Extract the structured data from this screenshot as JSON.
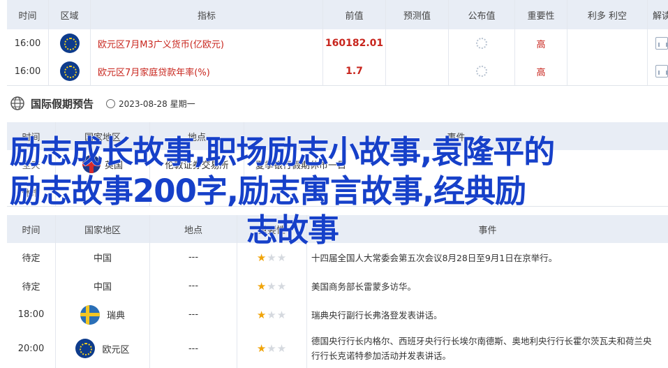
{
  "top_table": {
    "headers": [
      "时间",
      "区域",
      "指标",
      "前值",
      "预测值",
      "公布值",
      "重要性",
      "利多 利空",
      "解读"
    ],
    "rows": [
      {
        "time": "16:00",
        "region_icon": "eu-flag-icon",
        "indicator": "欧元区7月M3广义货币(亿欧元)",
        "previous": "160182.01",
        "forecast": "",
        "published": "",
        "importance": "高"
      },
      {
        "time": "16:00",
        "region_icon": "eu-flag-icon",
        "indicator": "欧元区7月家庭贷款年率(%)",
        "previous": "1.7",
        "forecast": "",
        "published": "",
        "importance": "高"
      }
    ]
  },
  "holiday_section": {
    "title": "国际假期预告",
    "date": "2023-08-28 星期一",
    "headers": [
      "时间",
      "国家地区",
      "地点",
      "事件"
    ],
    "partial_row": {
      "time": "全天",
      "country": "英国",
      "place": "伦敦证券交易所",
      "event": "夏季银行假期休市一日"
    },
    "partial_row2": {
      "time": "休市"
    }
  },
  "event_section": {
    "headers": [
      "时间",
      "国家地区",
      "地点",
      "重要性",
      "事件"
    ],
    "rows": [
      {
        "time": "待定",
        "country": "中国",
        "place": "---",
        "stars": 1,
        "event": "十四届全国人大常委会第五次会议8月28日至9月1日在京举行。"
      },
      {
        "time": "待定",
        "country": "中国",
        "place": "---",
        "stars": 1,
        "event": "美国商务部长雷蒙多访华。"
      },
      {
        "time": "18:00",
        "country": "瑞典",
        "place": "---",
        "stars": 1,
        "event": "瑞典央行副行长弗洛登发表讲话。"
      },
      {
        "time": "20:00",
        "country": "欧元区",
        "place": "---",
        "stars": 1,
        "event": "德国央行行长内格尔、西班牙央行行长埃尔南德斯、奥地利央行行长霍尔茨瓦夫和荷兰央行行长克诺特参加活动并发表讲话。"
      }
    ]
  },
  "overlay_title": {
    "line1": "励志成长故事,职场励志小故事,袁隆平的",
    "line2": "励志故事200字,励志寓言故事,经典励",
    "line3": "志故事"
  },
  "colors": {
    "accent": "#1640c9",
    "header_bg": "#e8edf5",
    "high": "#c8251d",
    "star": "#f0a40a"
  }
}
